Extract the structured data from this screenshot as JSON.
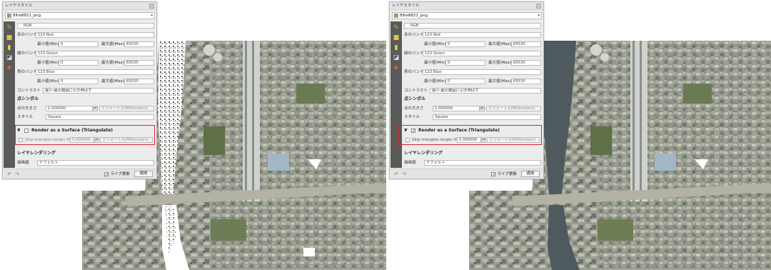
{
  "left_panel": {
    "title": "レイヤスタイル",
    "layer": "8lhe8821_png",
    "renderer": "RGB",
    "red_band_label": "赤のバンド",
    "red_band": "Red",
    "green_band_label": "緑のバンド",
    "green_band": "Green",
    "blue_band_label": "青のバンド",
    "blue_band": "Blue",
    "min_label": "最小値(Min)",
    "max_label": "最大値(Max)",
    "min_value": "0",
    "max_value": "65535",
    "contrast_label": "コントラスト",
    "contrast_value": "最小-最大範囲に引き伸ばす",
    "point_symbol": "点シンボル",
    "point_size_label": "点の大きさ",
    "point_size": "1.000000",
    "point_unit": "ミリメートル(Millimeters)",
    "style_label": "スタイル",
    "style_value": "Square",
    "surface_label": "Render as a Surface (Triangulate)",
    "surface_checked": "",
    "skip_label": "Skip triangles longer than",
    "skip_value": "5.000000",
    "skip_unit": "ミリメートル(Millimeters)",
    "layer_rendering": "レイヤレンダリング",
    "blend_label": "描画順",
    "blend_value": "デフォルト",
    "live_update": "ライブ更新",
    "live_checked": "✓",
    "apply": "適用"
  },
  "right_panel": {
    "title": "レイヤスタイル",
    "layer": "8lhe8821_png",
    "renderer": "RGB",
    "red_band_label": "赤のバンド",
    "red_band": "Red",
    "green_band_label": "緑のバンド",
    "green_band": "Green",
    "blue_band_label": "青のバンド",
    "blue_band": "Blue",
    "min_label": "最小値(Min)",
    "max_label": "最大値(Max)",
    "min_value": "0",
    "max_value": "65535",
    "contrast_label": "コントラスト",
    "contrast_value": "最小-最大範囲に引き伸ばす",
    "point_symbol": "点シンボル",
    "point_size_label": "点の大きさ",
    "point_size": "1.000000",
    "point_unit": "ミリメートル(Millimeters)",
    "style_label": "スタイル",
    "style_value": "Square",
    "surface_label": "Render as a Surface (Triangulate)",
    "surface_checked": "✓",
    "skip_label": "Skip triangles longer than",
    "skip_value": "5.000000",
    "skip_unit": "ミリメートル(Millimeters)",
    "layer_rendering": "レイヤレンダリング",
    "blend_label": "描画順",
    "blend_value": "デフォルト",
    "live_update": "ライブ更新",
    "live_checked": "✓",
    "apply": "適用"
  },
  "band_prefix": "123",
  "colors": {
    "highlight": "#e0272b",
    "water": "#4e5a5e",
    "toolstrip": "#5a5a5a"
  },
  "icons": [
    "paintbrush-icon",
    "cube-icon",
    "label-icon",
    "mask-icon",
    "layers-icon",
    "undo-icon",
    "redo-icon"
  ]
}
